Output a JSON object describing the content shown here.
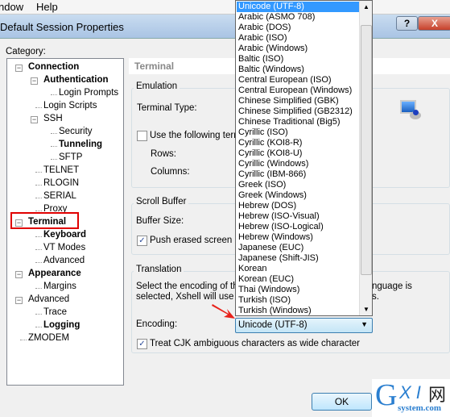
{
  "menu": [
    "ndow",
    "Help"
  ],
  "window": {
    "title": "Default Session Properties",
    "help": "?",
    "close": "X"
  },
  "category_label": "Category:",
  "tree": [
    {
      "label": "Connection",
      "bold": true,
      "level": 0,
      "expander": "-"
    },
    {
      "label": "Authentication",
      "bold": true,
      "level": 1,
      "expander": "-"
    },
    {
      "label": "Login Prompts",
      "level": 2
    },
    {
      "label": "Login Scripts",
      "level": 1
    },
    {
      "label": "SSH",
      "level": 1,
      "expander": "-"
    },
    {
      "label": "Security",
      "level": 2
    },
    {
      "label": "Tunneling",
      "bold": true,
      "level": 2
    },
    {
      "label": "SFTP",
      "level": 2
    },
    {
      "label": "TELNET",
      "level": 1
    },
    {
      "label": "RLOGIN",
      "level": 1
    },
    {
      "label": "SERIAL",
      "level": 1
    },
    {
      "label": "Proxy",
      "level": 1
    },
    {
      "label": "Terminal",
      "bold": true,
      "level": 0,
      "expander": "-",
      "highlighted": true
    },
    {
      "label": "Keyboard",
      "bold": true,
      "level": 1
    },
    {
      "label": "VT Modes",
      "level": 1
    },
    {
      "label": "Advanced",
      "level": 1
    },
    {
      "label": "Appearance",
      "bold": true,
      "level": 0,
      "expander": "-"
    },
    {
      "label": "Margins",
      "level": 1
    },
    {
      "label": "Advanced",
      "level": 0,
      "expander": "-"
    },
    {
      "label": "Trace",
      "level": 1
    },
    {
      "label": "Logging",
      "bold": true,
      "level": 1
    },
    {
      "label": "ZMODEM",
      "level": 0
    }
  ],
  "panel": {
    "header": "Terminal",
    "emulation": {
      "title": "Emulation",
      "terminal_type": "Terminal Type:",
      "use_following": "Use the following term",
      "rows": "Rows:",
      "columns": "Columns:"
    },
    "scroll": {
      "title": "Scroll Buffer",
      "buffer_size": "Buffer Size:",
      "push": "Push erased screen int"
    },
    "translation": {
      "title": "Translation",
      "desc1": "Select the encoding of the",
      "desc1b": "nguage is",
      "desc2": "selected, Xshell will use th",
      "desc2b": "s.",
      "encoding_label": "Encoding:",
      "encoding_value": "Unicode (UTF-8)",
      "cjk": "Treat CJK ambiguous characters as wide character"
    }
  },
  "dropdown": {
    "options": [
      "Unicode (UTF-8)",
      "Arabic (ASMO 708)",
      "Arabic (DOS)",
      "Arabic (ISO)",
      "Arabic (Windows)",
      "Baltic (ISO)",
      "Baltic (Windows)",
      "Central European (ISO)",
      "Central European (Windows)",
      "Chinese Simplified (GBK)",
      "Chinese Simplified (GB2312)",
      "Chinese Traditional (Big5)",
      "Cyrillic (ISO)",
      "Cyrillic (KOI8-R)",
      "Cyrillic (KOI8-U)",
      "Cyrillic (Windows)",
      "Cyrillic (IBM-866)",
      "Greek (ISO)",
      "Greek (Windows)",
      "Hebrew (DOS)",
      "Hebrew (ISO-Visual)",
      "Hebrew (ISO-Logical)",
      "Hebrew (Windows)",
      "Japanese (EUC)",
      "Japanese (Shift-JIS)",
      "Korean",
      "Korean (EUC)",
      "Thai (Windows)",
      "Turkish (ISO)",
      "Turkish (Windows)"
    ],
    "selected": "Unicode (UTF-8)"
  },
  "ok": "OK",
  "watermark": {
    "logo": "GXI网",
    "sub": "system.com"
  },
  "colors": {
    "highlight": "#e00000",
    "selection": "#3399ff",
    "arrow": "#e8221b"
  }
}
